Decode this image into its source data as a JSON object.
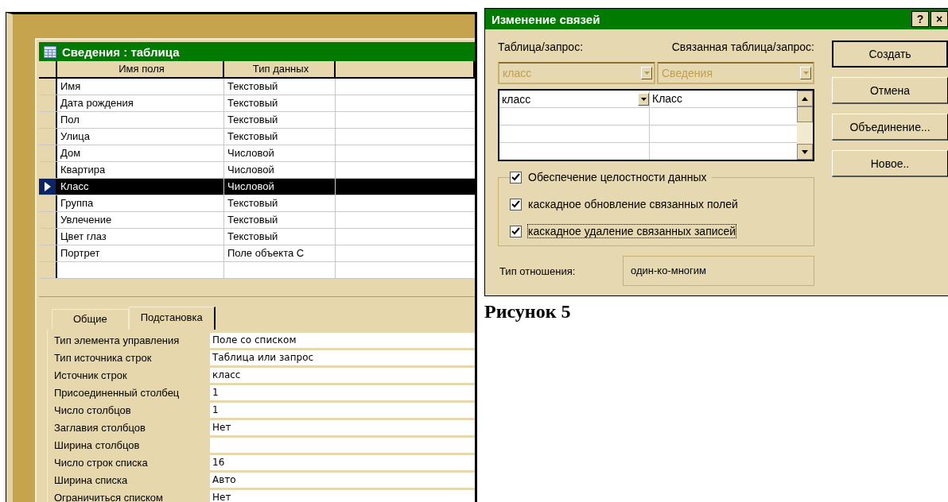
{
  "table_window": {
    "title": "Сведения : таблица",
    "columns": [
      "Имя поля",
      "Тип данных"
    ],
    "rows": [
      {
        "name": "Имя",
        "type": "Текстовый",
        "selected": false
      },
      {
        "name": "Дата рождения",
        "type": "Текстовый",
        "selected": false
      },
      {
        "name": "Пол",
        "type": "Текстовый",
        "selected": false
      },
      {
        "name": "Улица",
        "type": "Текстовый",
        "selected": false
      },
      {
        "name": "Дом",
        "type": "Числовой",
        "selected": false
      },
      {
        "name": "Квартира",
        "type": "Числовой",
        "selected": false
      },
      {
        "name": "Класс",
        "type": "Числовой",
        "selected": true
      },
      {
        "name": "Группа",
        "type": "Текстовый",
        "selected": false
      },
      {
        "name": "Увлечение",
        "type": "Текстовый",
        "selected": false
      },
      {
        "name": "Цвет глаз",
        "type": "Текстовый",
        "selected": false
      },
      {
        "name": "Портрет",
        "type": "Поле объекта С",
        "selected": false
      }
    ],
    "tabs": [
      {
        "label": "Общие",
        "selected": false
      },
      {
        "label": "Подстановка",
        "selected": true
      }
    ],
    "properties": [
      {
        "label": "Тип элемента управления",
        "value": "Поле со списком"
      },
      {
        "label": "Тип источника строк",
        "value": "Таблица или запрос"
      },
      {
        "label": "Источник строк",
        "value": "класс"
      },
      {
        "label": "Присоединенный столбец",
        "value": "1"
      },
      {
        "label": "Число столбцов",
        "value": "1"
      },
      {
        "label": "Заглавия столбцов",
        "value": "Нет"
      },
      {
        "label": "Ширина столбцов"
      },
      {
        "label": "Число строк списка",
        "value": "16"
      },
      {
        "label": "Ширина списка",
        "value": "Авто"
      },
      {
        "label": "Ограничиться списком",
        "value": "Нет"
      }
    ]
  },
  "dialog": {
    "title": "Изменение связей",
    "title_buttons": [
      "?",
      "×"
    ],
    "table_label": "Таблица/запрос:",
    "related_label": "Связанная таблица/запрос:",
    "table_combo": {
      "value": "класс",
      "disabled": true
    },
    "related_combo": {
      "value": "Сведения",
      "disabled": true
    },
    "field_rows": [
      {
        "field": "класс",
        "related": "Класс"
      }
    ],
    "checks": [
      {
        "label": "Обеспечение целостности данных",
        "checked": true,
        "focused": false
      },
      {
        "label": "каскадное обновление связанных полей",
        "checked": true,
        "focused": false
      },
      {
        "label": "каскадное удаление связанных записей",
        "checked": true,
        "focused": true
      }
    ],
    "relation_label": "Тип отношения:",
    "relation_value": "один-ко-многим",
    "buttons": [
      "Создать",
      "Отмена",
      "Объединение...",
      "Новое.."
    ]
  },
  "figure_caption": "Рисунок 5"
}
